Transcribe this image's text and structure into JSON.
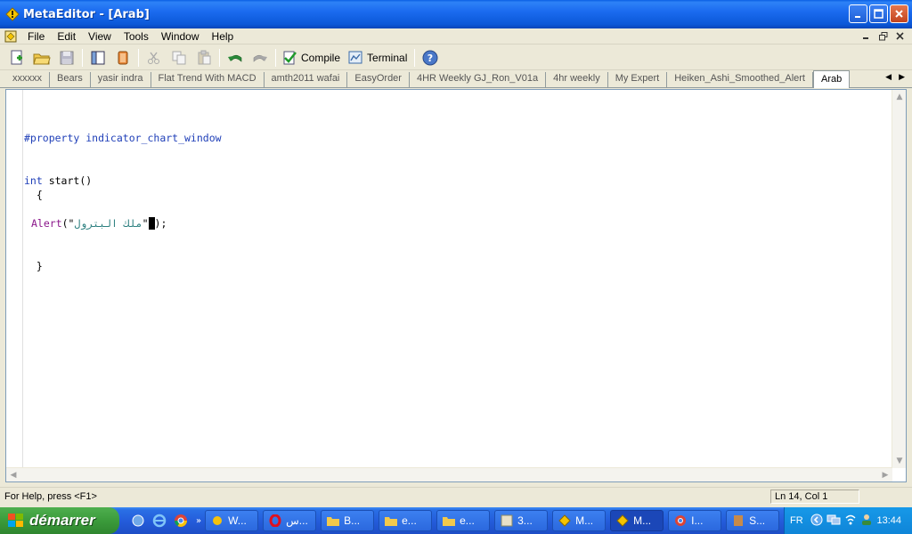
{
  "window": {
    "title": "MetaEditor - [Arab]"
  },
  "menu": {
    "items": [
      "File",
      "Edit",
      "View",
      "Tools",
      "Window",
      "Help"
    ]
  },
  "toolbar": {
    "compile_label": "Compile",
    "terminal_label": "Terminal"
  },
  "tabs": [
    "xxxxxx",
    "Bears",
    "yasir indra",
    "Flat Trend With MACD",
    "amth2011 wafai",
    "EasyOrder",
    "4HR Weekly GJ_Ron_V01a",
    "4hr weekly",
    "My Expert",
    "Heiken_Ashi_Smoothed_Alert",
    "Arab"
  ],
  "active_tab": "Arab",
  "code": {
    "line1": "#property indicator_chart_window",
    "line2_kw": "int",
    "line2_rest": " start()",
    "line3": "  {",
    "line4_fn": "Alert",
    "line4_open": "(\"",
    "line4_str": "ملك البترول",
    "line4_quote": "\"",
    "line4_close": ");",
    "line5": "  }"
  },
  "status": {
    "help": "For Help, press <F1>",
    "position": "Ln 14, Col 1"
  },
  "taskbar": {
    "start_label": "démarrer",
    "tasks": [
      "W...",
      "س...",
      "B...",
      "e...",
      "e...",
      "3...",
      "M...",
      "M...",
      "I...",
      "S..."
    ],
    "language": "FR",
    "clock": "13:44"
  },
  "colors": {
    "title_bar": "#1B6BEF",
    "keyword_blue": "#1F3FB8",
    "function_purple": "#8B168B",
    "string_teal": "#2B7F7F",
    "start_green": "#3B9B3B"
  }
}
